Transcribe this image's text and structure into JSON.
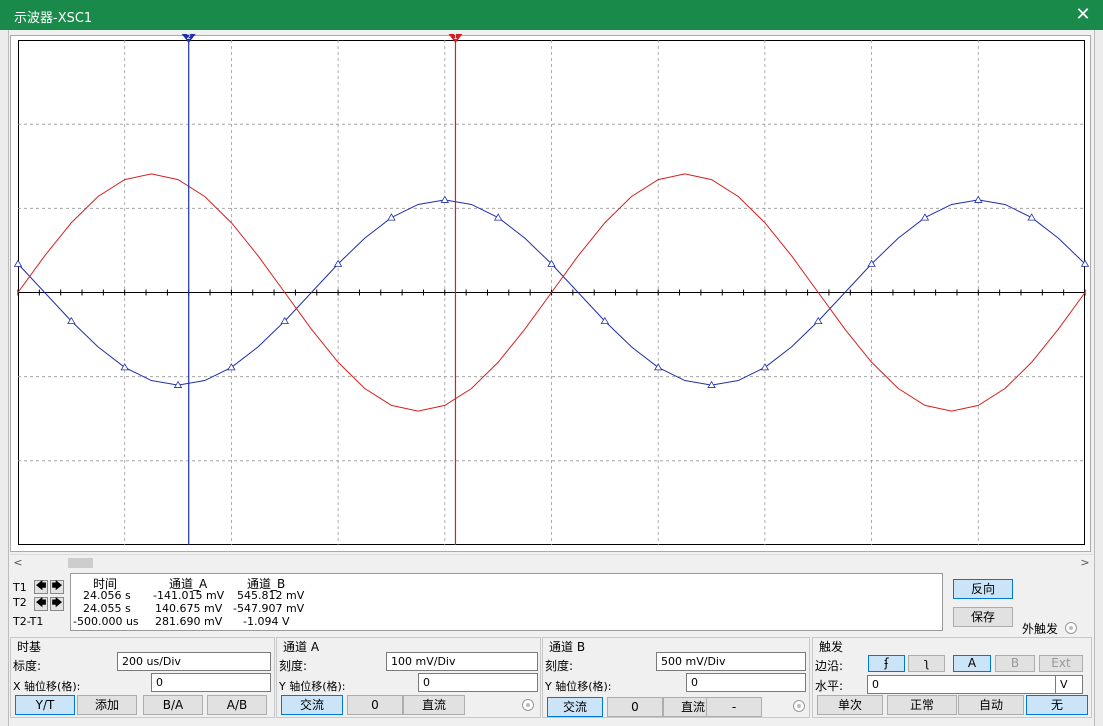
{
  "window": {
    "title": "示波器-XSC1",
    "close": "✕"
  },
  "colors": {
    "channel_a": "#1f2fa8",
    "channel_b": "#d42020",
    "cursor1": "#d42020",
    "cursor2": "#1f2fa8",
    "titlebar": "#1a8a4a"
  },
  "chart_data": {
    "type": "line",
    "x_range_div": [
      0,
      10
    ],
    "y_range_div": [
      -3,
      3
    ],
    "grid": true,
    "series": [
      {
        "name": "通道_A",
        "color": "#1f2fa8",
        "amplitude_div": 1.1,
        "period_div": 5.0,
        "zero_cross_div": 2.75,
        "shape": "sine_rising_at_zero_cross",
        "markers": "triangle"
      },
      {
        "name": "通道_B",
        "color": "#d42020",
        "amplitude_div": 1.41,
        "period_div": 5.0,
        "zero_cross_div": 0.0,
        "shape": "sine_rising_at_zero_cross"
      }
    ],
    "cursors": [
      {
        "id": "1",
        "color": "#d42020",
        "x_div": 4.1
      },
      {
        "id": "2",
        "color": "#1f2fa8",
        "x_div": 1.6
      }
    ]
  },
  "cursor_panel": {
    "t1": "T1",
    "t2": "T2",
    "t2t1": "T2-T1",
    "left_arrow": "🡄",
    "right_arrow": "🡆"
  },
  "readout": {
    "headers": [
      "时间",
      "通道_A",
      "通道_B"
    ],
    "rows": [
      [
        "24.056 s",
        "-141.015 mV",
        "545.812 mV"
      ],
      [
        "24.055 s",
        "140.675 mV",
        "-547.907 mV"
      ],
      [
        "-500.000 us",
        "281.690 mV",
        "-1.094 V"
      ]
    ]
  },
  "side_buttons": {
    "reverse": "反向",
    "save": "保存",
    "ext_trigger": "外触发"
  },
  "timebase": {
    "title": "时基",
    "scale_label": "标度:",
    "scale_value": "200 us/Div",
    "xpos_label": "X 轴位移(格):",
    "xpos_value": "0",
    "buttons": [
      "Y/T",
      "添加",
      "B/A",
      "A/B"
    ]
  },
  "channel_a": {
    "title": "通道 A",
    "scale_label": "刻度:",
    "scale_value": "100 mV/Div",
    "ypos_label": "Y 轴位移(格):",
    "ypos_value": "0",
    "buttons": [
      "交流",
      "0",
      "直流"
    ]
  },
  "channel_b": {
    "title": "通道 B",
    "scale_label": "刻度:",
    "scale_value": "500 mV/Div",
    "ypos_label": "Y 轴位移(格):",
    "ypos_value": "0",
    "buttons": [
      "交流",
      "0",
      "直流",
      "-"
    ]
  },
  "trigger": {
    "title": "触发",
    "edge_label": "边沿:",
    "edge_rise": "ʄ",
    "edge_fall": "ʅ",
    "sources": [
      "A",
      "B",
      "Ext"
    ],
    "level_label": "水平:",
    "level_value": "0",
    "level_unit": "V",
    "modes": [
      "单次",
      "正常",
      "自动",
      "无"
    ]
  }
}
